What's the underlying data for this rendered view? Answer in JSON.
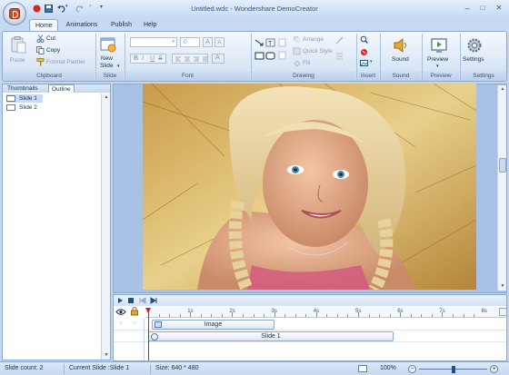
{
  "window": {
    "title": "Untitled.wdc - Wondershare DemoCreator",
    "min": "–",
    "max": "□",
    "close": "✕"
  },
  "tabs": [
    {
      "label": "Home"
    },
    {
      "label": "Animations"
    },
    {
      "label": "Publish"
    },
    {
      "label": "Help"
    }
  ],
  "clipboard": {
    "paste": "Paste",
    "cut": "Cut",
    "copy": "Copy",
    "format_painter": "Format Painter",
    "label": "Clipboard"
  },
  "slide": {
    "new_slide_1": "New",
    "new_slide_2": "Slide",
    "label": "Slide"
  },
  "font": {
    "size": "0",
    "label": "Font",
    "bold": "B",
    "italic": "I",
    "underline": "U",
    "strike": "S"
  },
  "drawing": {
    "arrange": "Arrange",
    "quick_style": "Quick Style",
    "fill": "Fill",
    "label": "Drawing"
  },
  "insert": {
    "label": "Insert"
  },
  "sound": {
    "button": "Sound",
    "label": "Sound"
  },
  "preview": {
    "button": "Preview",
    "label": "Preview"
  },
  "settings": {
    "button": "Settings",
    "label": "Settings"
  },
  "panel": {
    "tab_thumbnails": "Thumbnails",
    "tab_outline": "Outline",
    "slides": [
      {
        "label": "Slide 1"
      },
      {
        "label": "Slide 2"
      }
    ]
  },
  "timeline": {
    "ticks": [
      "1s",
      "2s",
      "3s",
      "4s",
      "5s",
      "6s",
      "7s",
      "8s"
    ],
    "image_track": "Image",
    "slide_track": "Slide 1"
  },
  "status": {
    "slide_count": "Slide count: 2",
    "current_slide": "Current Slide :Slide 1",
    "size": "Size: 640 * 480",
    "zoom": "100%"
  },
  "colors": {
    "accent": "#1f4e8c",
    "ribbon_bg": "#dbe7f6",
    "canvas_bg": "#a8c1e4",
    "playhead": "#d0201c"
  }
}
